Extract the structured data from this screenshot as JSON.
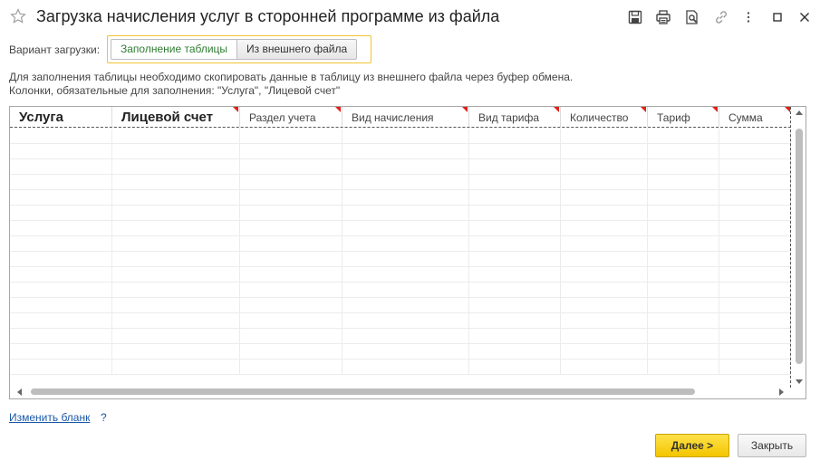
{
  "window": {
    "title": "Загрузка начисления услуг в сторонней программе из файла",
    "toolbar_icons": [
      "save-icon",
      "print-icon",
      "preview-icon",
      "link-icon",
      "more-icon",
      "maximize-icon",
      "close-icon"
    ]
  },
  "variant": {
    "label": "Вариант загрузки:",
    "options": [
      "Заполнение таблицы",
      "Из внешнего файла"
    ],
    "selected": "Заполнение таблицы"
  },
  "info": {
    "line1": "Для заполнения таблицы необходимо скопировать данные в таблицу из внешнего файла через буфер обмена.",
    "line2": "Колонки, обязательные для заполнения: \"Услуга\", \"Лицевой счет\""
  },
  "table": {
    "columns": [
      "Услуга",
      "Лицевой счет",
      "Раздел  учета",
      "Вид начисления",
      "Вид тарифа",
      "Количество",
      "Тариф",
      "Сумма"
    ],
    "rows": []
  },
  "footer": {
    "change_form_link": "Изменить бланк",
    "help": "?",
    "next_button": "Далее >",
    "close_button": "Закрыть"
  },
  "colors": {
    "accent_yellow": "#f3c500",
    "active_option_green": "#2e7d32",
    "link_blue": "#1a57a8",
    "required_marker_red": "#e0201a"
  }
}
